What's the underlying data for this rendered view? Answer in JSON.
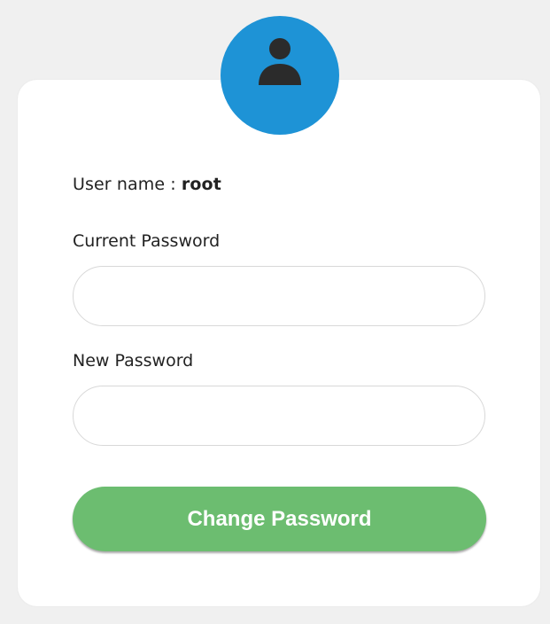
{
  "avatar": {
    "icon": "user-icon",
    "color": "#1e93d6"
  },
  "user": {
    "label": "User name : ",
    "value": "root"
  },
  "current_password": {
    "label": "Current Password",
    "value": "",
    "placeholder": ""
  },
  "new_password": {
    "label": "New Password",
    "value": "",
    "placeholder": ""
  },
  "submit": {
    "label": "Change Password",
    "color": "#6cbd70"
  }
}
